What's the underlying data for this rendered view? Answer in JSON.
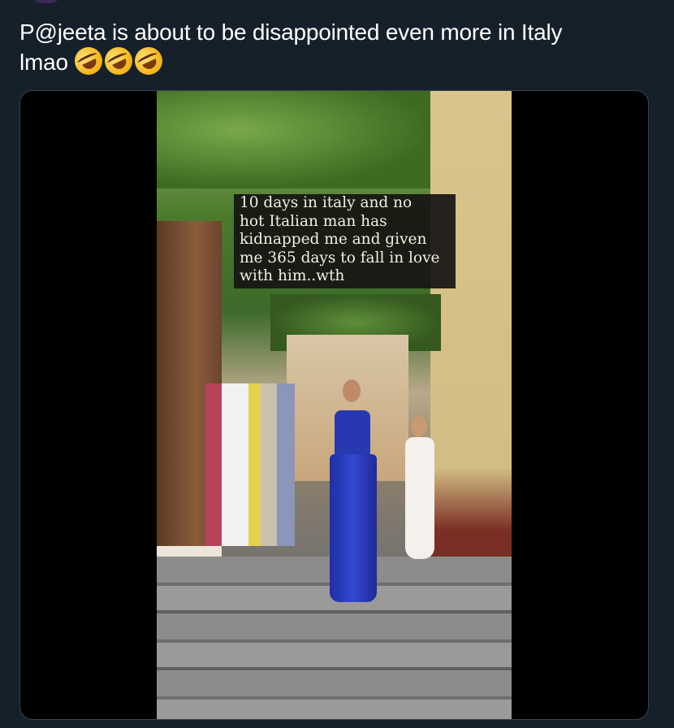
{
  "tweet": {
    "text_line1": "P@jeeta is about to be disappointed even more in Italy",
    "text_line2": "lmao",
    "emojis": [
      "rolling-on-the-floor-laughing",
      "rolling-on-the-floor-laughing",
      "rolling-on-the-floor-laughing"
    ]
  },
  "media": {
    "type": "video",
    "caption_lines": [
      "10 days in italy and no",
      "hot Italian man has",
      "kidnapped me and given",
      "me 365 days to fall in love",
      "with him..wth"
    ]
  },
  "colors": {
    "background": "#15202b",
    "text": "#ffffff",
    "card_border": "#38444d"
  }
}
